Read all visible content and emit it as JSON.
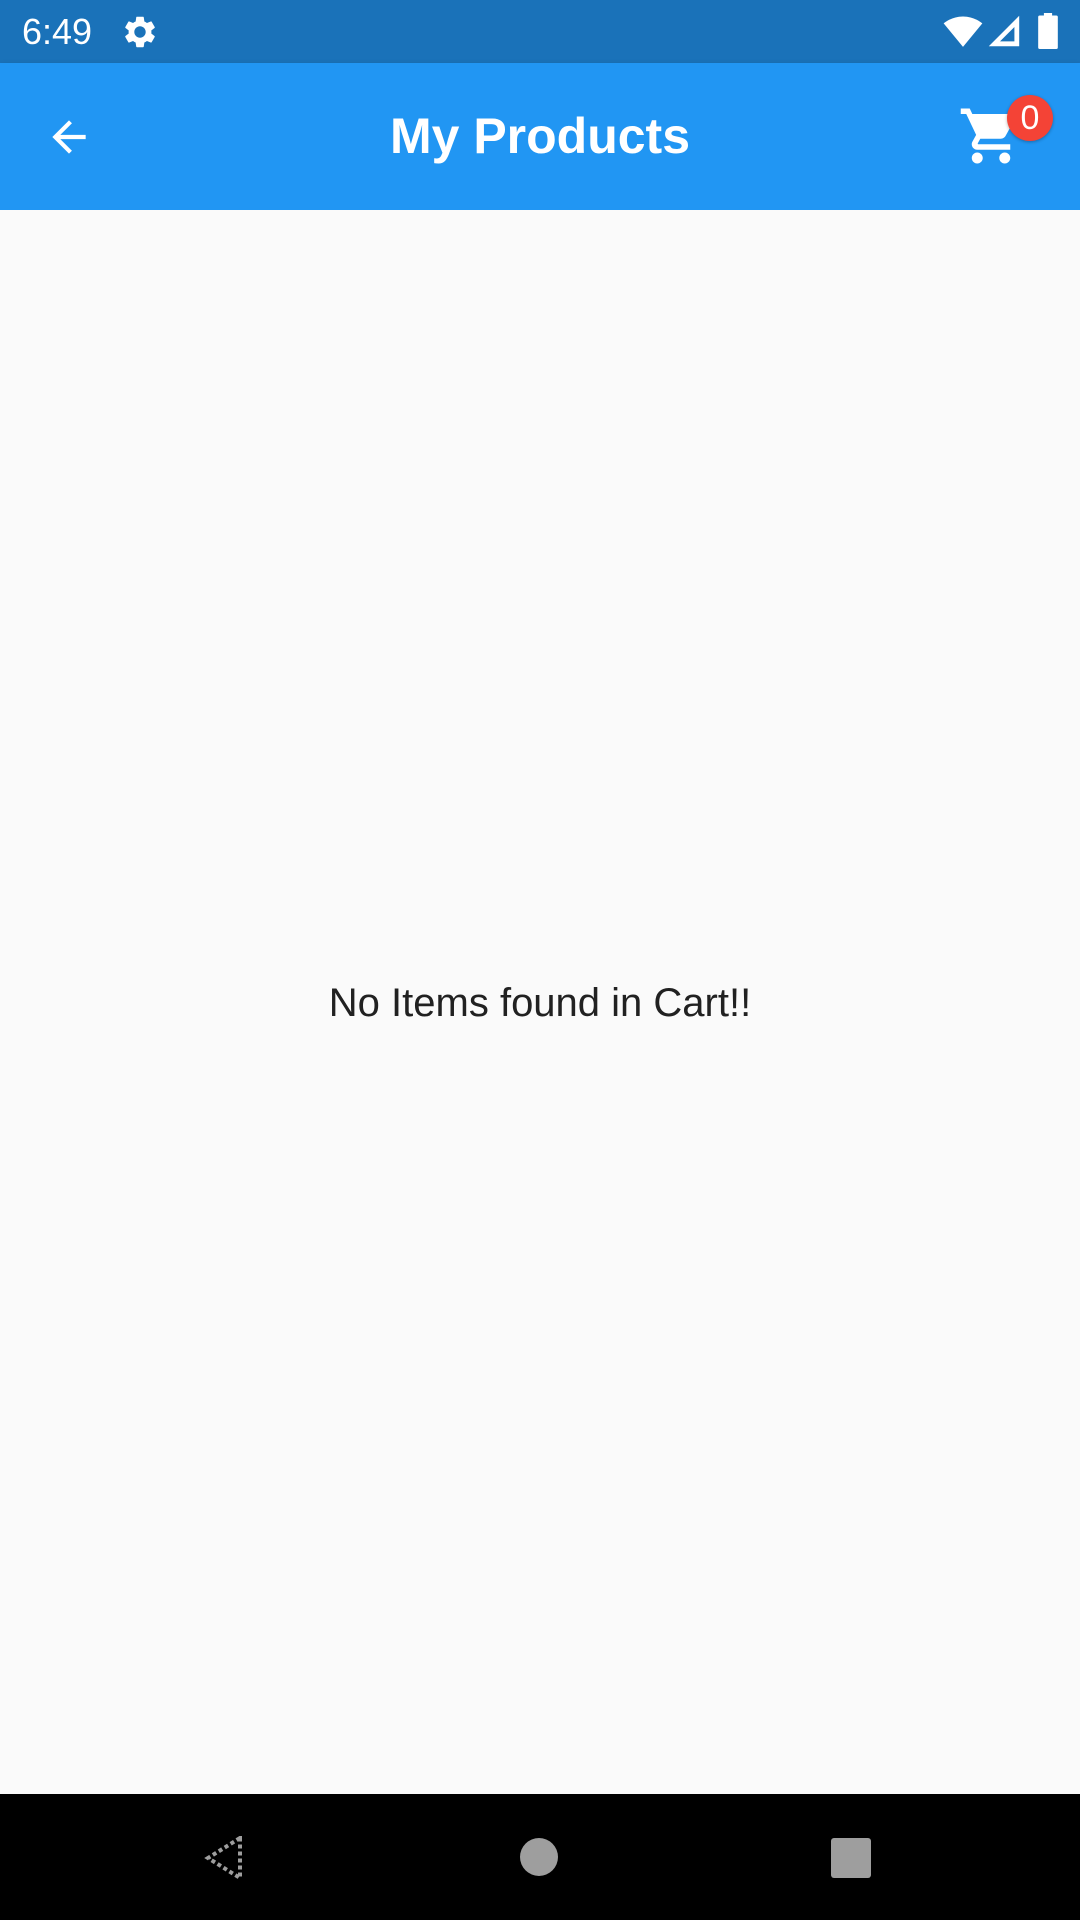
{
  "status_bar": {
    "time": "6:49",
    "icons": [
      "settings-icon",
      "wifi-icon",
      "signal-icon",
      "battery-icon"
    ]
  },
  "app_bar": {
    "title": "My Products",
    "back_icon": "arrow-back-icon",
    "cart_icon": "shopping-cart-icon",
    "cart_count": "0"
  },
  "content": {
    "empty_message": "No Items found in Cart!!"
  },
  "nav_bar": {
    "icons": [
      "back-triangle-icon",
      "home-circle-icon",
      "recents-square-icon"
    ]
  },
  "colors": {
    "status_bar": "#1a72b9",
    "app_bar": "#2196f3",
    "badge": "#f44336",
    "background": "#fafafa",
    "nav_bar": "#000000"
  }
}
